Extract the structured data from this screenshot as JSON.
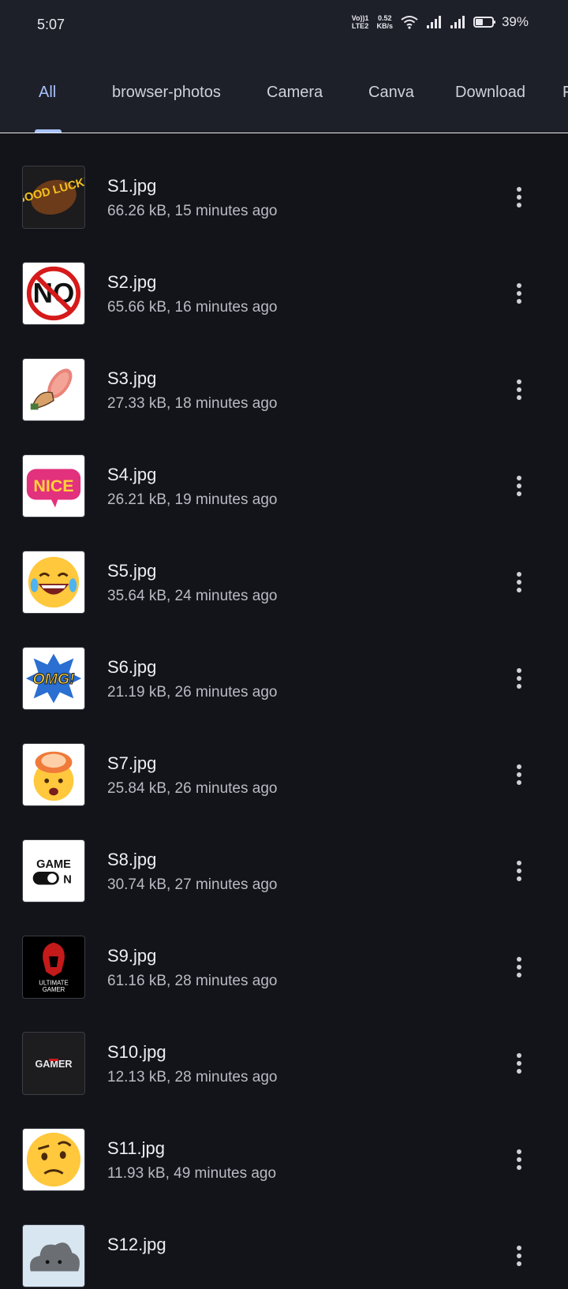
{
  "status_bar": {
    "time": "5:07",
    "network_top": "Vo))1",
    "network_bottom": "LTE2",
    "speed_top": "0.52",
    "speed_bottom": "KB/s",
    "battery_percent": "39%",
    "battery_level": 0.39,
    "icons": [
      "wifi-icon",
      "signal-icon",
      "signal-icon",
      "battery-icon"
    ]
  },
  "tabs": [
    {
      "label": "All",
      "active": true
    },
    {
      "label": "browser-photos"
    },
    {
      "label": "Camera"
    },
    {
      "label": "Canva"
    },
    {
      "label": "Download"
    },
    {
      "label": "F"
    }
  ],
  "files": [
    {
      "name": "S1.jpg",
      "meta": "66.26 kB, 15 minutes ago",
      "thumb": "good-luck-sticker",
      "thumb_text": "GOOD LUCK!"
    },
    {
      "name": "S2.jpg",
      "meta": "65.66 kB, 16 minutes ago",
      "thumb": "no-sign-sticker",
      "thumb_text": "NO"
    },
    {
      "name": "S3.jpg",
      "meta": "27.33 kB, 18 minutes ago",
      "thumb": "slipper-hand-sticker"
    },
    {
      "name": "S4.jpg",
      "meta": "26.21 kB, 19 minutes ago",
      "thumb": "nice-sticker",
      "thumb_text": "NICE"
    },
    {
      "name": "S5.jpg",
      "meta": "35.64 kB, 24 minutes ago",
      "thumb": "laughing-emoji"
    },
    {
      "name": "S6.jpg",
      "meta": "21.19 kB, 26 minutes ago",
      "thumb": "omg-sticker",
      "thumb_text": "OMG!"
    },
    {
      "name": "S7.jpg",
      "meta": "25.84 kB, 26 minutes ago",
      "thumb": "mind-blown-emoji"
    },
    {
      "name": "S8.jpg",
      "meta": "30.74 kB, 27 minutes ago",
      "thumb": "game-on-logo",
      "thumb_text": "GAME ON"
    },
    {
      "name": "S9.jpg",
      "meta": "61.16 kB, 28 minutes ago",
      "thumb": "ultimate-gamer-logo",
      "thumb_text": "ULTIMATE GAMER"
    },
    {
      "name": "S10.jpg",
      "meta": "12.13 kB, 28 minutes ago",
      "thumb": "gamer-logo",
      "thumb_text": "GAMER"
    },
    {
      "name": "S11.jpg",
      "meta": "11.93 kB, 49 minutes ago",
      "thumb": "raised-eyebrow-emoji"
    },
    {
      "name": "S12.jpg",
      "meta": "",
      "thumb": "cloud-sticker"
    }
  ],
  "colors": {
    "background": "#131419",
    "header": "#1e2029",
    "accent": "#a8c2ff"
  }
}
